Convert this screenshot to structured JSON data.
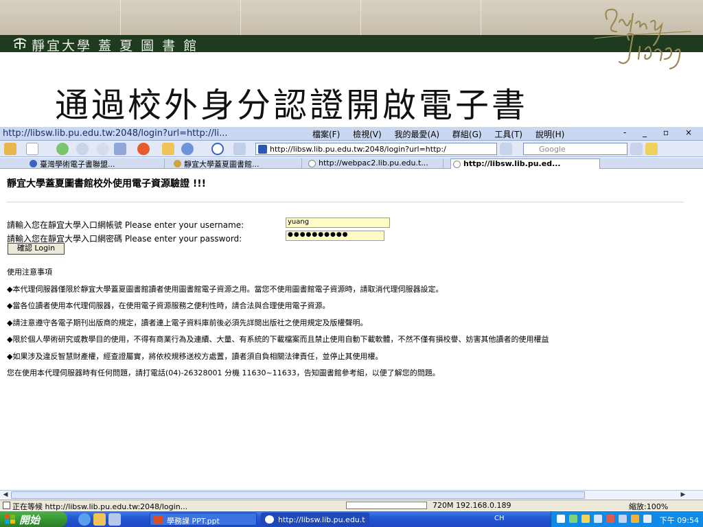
{
  "slide": {
    "university_name": "靜宜大學 蓋 夏 圖 書 館",
    "title": "通過校外身分認證開啟電子書"
  },
  "browser": {
    "window_title": "http://libsw.lib.pu.edu.tw:2048/login?url=http://li...",
    "menus": [
      "檔案(F)",
      "檢視(V)",
      "我的最愛(A)",
      "群組(G)",
      "工具(T)",
      "說明(H)"
    ],
    "window_buttons": "- _ ▫ ×",
    "address": "http://libsw.lib.pu.edu.tw:2048/login?url=http:/",
    "search_placeholder": "Google",
    "tabs": [
      {
        "label": "臺灣學術電子書聯盟..."
      },
      {
        "label": "靜宜大學蓋夏圖書館..."
      },
      {
        "label": "http://webpac2.lib.pu.edu.t..."
      },
      {
        "label": "http://libsw.lib.pu.ed..."
      }
    ]
  },
  "page": {
    "heading": "靜宜大學蓋夏圖書館校外使用電子資源驗證 !!!",
    "username_label": "請輸入您在靜宜大學入口網帳號 Please enter your username:",
    "username_value": "yuang",
    "password_label": "請輸入您在靜宜大學入口網密碼 Please enter your password:",
    "password_value": "●●●●●●●●●●",
    "login_button": "確認 Login",
    "notes_title": "使用注意事項",
    "notes": [
      "◆本代理伺服器僅限於靜宜大學蓋夏圖書館讀者使用圖書館電子資源之用。當您不使用圖書館電子資源時，請取消代理伺服器設定。",
      "◆當各位讀者使用本代理伺服器，在使用電子資源服務之便利性時，請合法與合理使用電子資源。",
      "◆請注意遵守各電子期刊出版商的規定，讀者連上電子資料庫前後必須先詳閱出版社之使用規定及版權聲明。",
      "◆限於個人學術研究或教學目的使用，不得有商業行為及連續、大量、有系統的下載檔案而且禁止使用自動下載軟體，不然不僅有損校譽、妨害其他讀者的使用權益",
      "◆如果涉及違反智慧財產權，經查證屬實，將依校規移送校方處置，讀者須自負相關法律責任，並停止其使用權。",
      "您在使用本代理伺服器時有任何問題，請打電話(04)-26328001 分機 11630~11633，告知圖書館參考組，以便了解您的問題。"
    ]
  },
  "statusbar": {
    "status": "正在等候 http://libsw.lib.pu.edu.tw:2048/login...",
    "progress": 0.0,
    "memory_ip": "720M 192.168.0.189",
    "zoom": "縮放:100%"
  },
  "taskbar": {
    "start": "開始",
    "buttons": [
      "學務課 PPT.ppt",
      "http://libsw.lib.pu.edu.t"
    ],
    "lang": "CH",
    "clock": "下午 09:54"
  },
  "colors": {
    "header_green": "#1f3b1f",
    "field_yellow": "#fffbc7",
    "taskbar_blue": "#2457d6",
    "start_green": "#34952f"
  }
}
